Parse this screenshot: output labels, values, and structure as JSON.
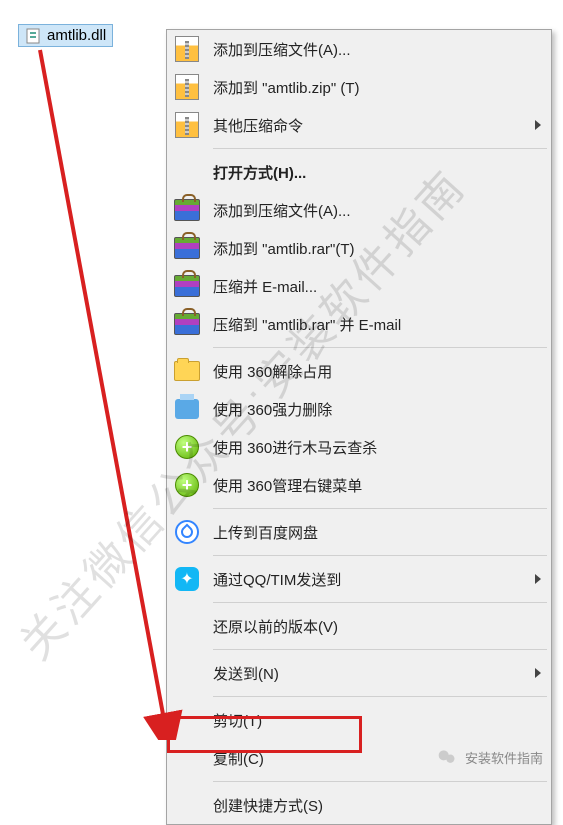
{
  "file": {
    "name": "amtlib.dll"
  },
  "menu": {
    "items": [
      {
        "label": "添加到压缩文件(A)...",
        "icon": "winzip"
      },
      {
        "label": "添加到 \"amtlib.zip\" (T)",
        "icon": "winzip"
      },
      {
        "label": "其他压缩命令",
        "icon": "winzip",
        "submenu": true
      }
    ],
    "items2": [
      {
        "label": "打开方式(H)...",
        "bold": true
      },
      {
        "label": "添加到压缩文件(A)...",
        "icon": "winrar"
      },
      {
        "label": "添加到 \"amtlib.rar\"(T)",
        "icon": "winrar"
      },
      {
        "label": "压缩并 E-mail...",
        "icon": "winrar"
      },
      {
        "label": "压缩到 \"amtlib.rar\" 并 E-mail",
        "icon": "winrar"
      }
    ],
    "items3": [
      {
        "label": "使用 360解除占用",
        "icon": "folder360"
      },
      {
        "label": "使用 360强力删除",
        "icon": "printer360"
      },
      {
        "label": "使用 360进行木马云查杀",
        "icon": "plus360"
      },
      {
        "label": "使用 360管理右键菜单",
        "icon": "plus360"
      }
    ],
    "items4": [
      {
        "label": "上传到百度网盘",
        "icon": "baidu"
      }
    ],
    "items5": [
      {
        "label": "通过QQ/TIM发送到",
        "icon": "qq",
        "submenu": true
      }
    ],
    "items6": [
      {
        "label": "还原以前的版本(V)"
      }
    ],
    "items7": [
      {
        "label": "发送到(N)",
        "submenu": true
      }
    ],
    "items8": [
      {
        "label": "剪切(T)"
      },
      {
        "label": "复制(C)",
        "highlight": true
      }
    ],
    "items9": [
      {
        "label": "创建快捷方式(S)"
      }
    ]
  },
  "watermark": "关注微信公众号:安装软件指南",
  "footer": "安装软件指南"
}
